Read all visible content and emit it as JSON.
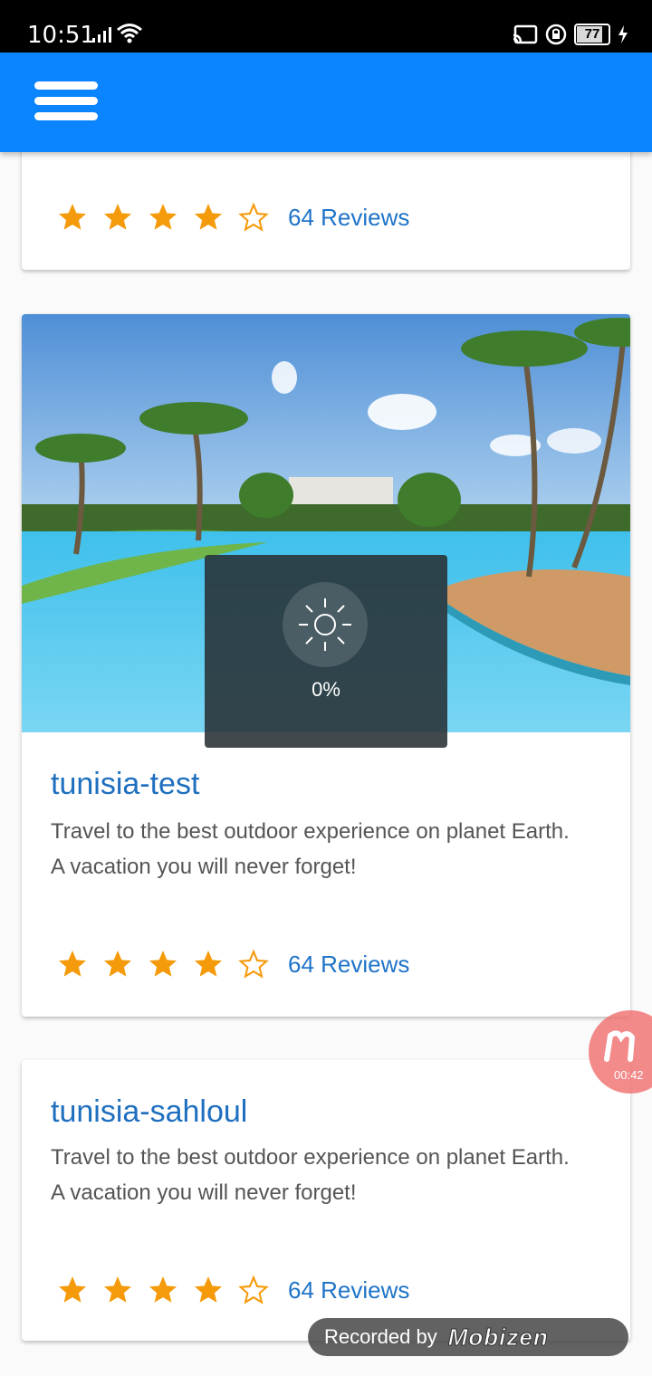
{
  "status_bar": {
    "time": "10:51",
    "battery": "77"
  },
  "app_bar": {
    "menu_icon": "hamburger-menu-icon"
  },
  "cards": [
    {
      "rating": {
        "filled_stars": 4,
        "total_stars": 5,
        "reviews_label": "64 Reviews"
      }
    },
    {
      "image": "resort-pool-palm-trees-photo",
      "title": "tunisia-test",
      "description_line1": "Travel to the best outdoor experience on planet Earth.",
      "description_line2": "A vacation you will never forget!",
      "rating": {
        "filled_stars": 4,
        "total_stars": 5,
        "reviews_label": "64 Reviews"
      }
    },
    {
      "title": "tunisia-sahloul",
      "description_line1": "Travel to the best outdoor experience on planet Earth.",
      "description_line2": "A vacation you will never forget!",
      "rating": {
        "filled_stars": 4,
        "total_stars": 5,
        "reviews_label": "64 Reviews"
      }
    }
  ],
  "loading": {
    "icon": "brightness-sun-icon",
    "percent": "0%"
  },
  "recording": {
    "timer": "00:42",
    "label": "Recorded by",
    "brand": "Mobizen"
  },
  "colors": {
    "app_bar": "#0a84ff",
    "title": "#1e6fbf",
    "star": "#f59b0b",
    "link": "#1f74c8"
  }
}
